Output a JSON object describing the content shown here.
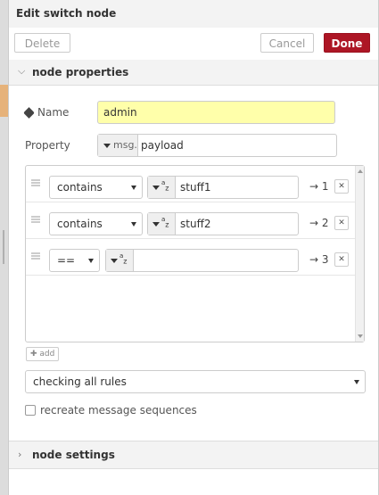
{
  "header": {
    "title": "Edit switch node"
  },
  "toolbar": {
    "delete_label": "Delete",
    "cancel_label": "Cancel",
    "done_label": "Done"
  },
  "sections": {
    "properties_label": "node properties",
    "settings_label": "node settings"
  },
  "form": {
    "name_label": "Name",
    "name_value": "admin",
    "property_label": "Property",
    "property_type": "msg.",
    "property_value": "payload"
  },
  "rules": [
    {
      "operator": "contains",
      "type": "az",
      "value": "stuff1",
      "output": "→ 1"
    },
    {
      "operator": "contains",
      "type": "az",
      "value": "stuff2",
      "output": "→ 2"
    },
    {
      "operator": "==",
      "type": "az",
      "value": "",
      "output": "→ 3"
    }
  ],
  "add_label": "add",
  "checking_mode": "checking all rules",
  "recreate_label": "recreate message sequences",
  "colors": {
    "done_button": "#ad1625",
    "name_input_bg": "#ffffaa",
    "tab_accent": "#e6b27a"
  }
}
